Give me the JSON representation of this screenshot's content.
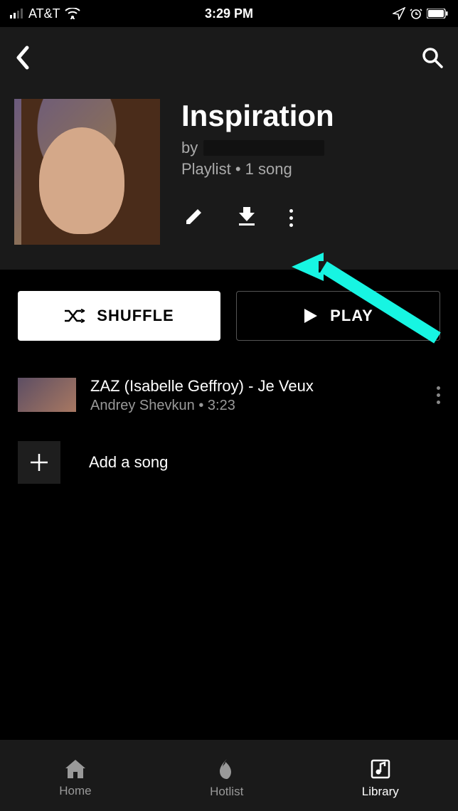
{
  "status_bar": {
    "carrier": "AT&T",
    "time": "3:29 PM"
  },
  "playlist": {
    "title": "Inspiration",
    "by_label": "by",
    "type_label": "Playlist",
    "song_count": "1 song"
  },
  "buttons": {
    "shuffle": "SHUFFLE",
    "play": "PLAY"
  },
  "songs": [
    {
      "title": "ZAZ (Isabelle Geffroy) - Je Veux",
      "artist": "Andrey Shevkun",
      "duration": "3:23"
    }
  ],
  "add_song_label": "Add a song",
  "nav": {
    "home": "Home",
    "hotlist": "Hotlist",
    "library": "Library"
  },
  "colors": {
    "annotation_arrow": "#17f5e2"
  }
}
